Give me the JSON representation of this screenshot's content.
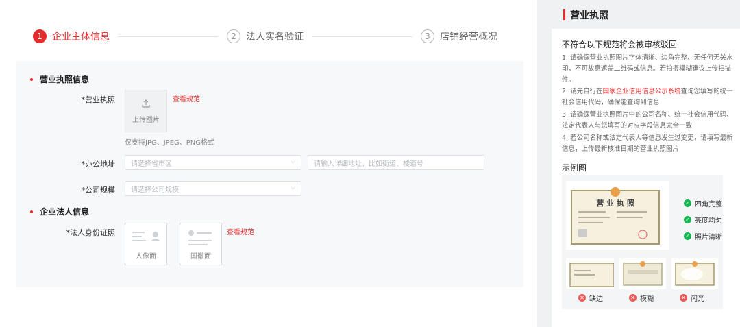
{
  "steps": [
    {
      "num": "1",
      "label": "企业主体信息"
    },
    {
      "num": "2",
      "label": "法人实名验证"
    },
    {
      "num": "3",
      "label": "店铺经营概况"
    }
  ],
  "form": {
    "section1_title": "营业执照信息",
    "license": {
      "label": "*营业执照",
      "upload_text": "上传图片",
      "spec_link": "查看规范",
      "formats": "仅支持JPG、JPEG、PNG格式"
    },
    "address": {
      "label": "*办公地址",
      "region_placeholder": "请选择省市区",
      "detail_placeholder": "请输入详细地址，比如街道、楼道号"
    },
    "scale": {
      "label": "*公司规模",
      "placeholder": "请选择公司规模"
    },
    "section2_title": "企业法人信息",
    "legal_id": {
      "label": "*法人身份证照",
      "front": "人像面",
      "back": "国徽面",
      "spec_link": "查看规范"
    }
  },
  "side": {
    "title": "营业执照",
    "rules_title": "不符合以下规范将会被审核驳回",
    "rule1": "1. 请确保营业执照图片字体清晰、边角完整、无任何无关水印，不可故意遮盖二维码或信息。若拍摄模糊建议上传扫描件。",
    "rule2_pre": "2. 请先自行在",
    "rule2_link": "国家企业信用信息公示系统",
    "rule2_post": "查询您填写的统一社会信用代码，确保能查询到信息",
    "rule3": "3. 请确保营业执照图片中的公司名称、统一社会信用代码、法定代表人与您填写的对应字段信息完全一致",
    "rule4": "4. 若公司名称或法定代表人等信息发生过变更，请填写最新信息，上传最新核准日期的营业执照图片",
    "example_label": "示例图",
    "cert_title": "营 业 执 照",
    "good": [
      "四角完整",
      "亮度均匀",
      "照片清晰"
    ],
    "bad": [
      "缺边",
      "模糊",
      "闪光"
    ]
  },
  "colors": {
    "accent": "#e42c2c",
    "ok": "#16b552",
    "bad": "#e85a5a"
  }
}
